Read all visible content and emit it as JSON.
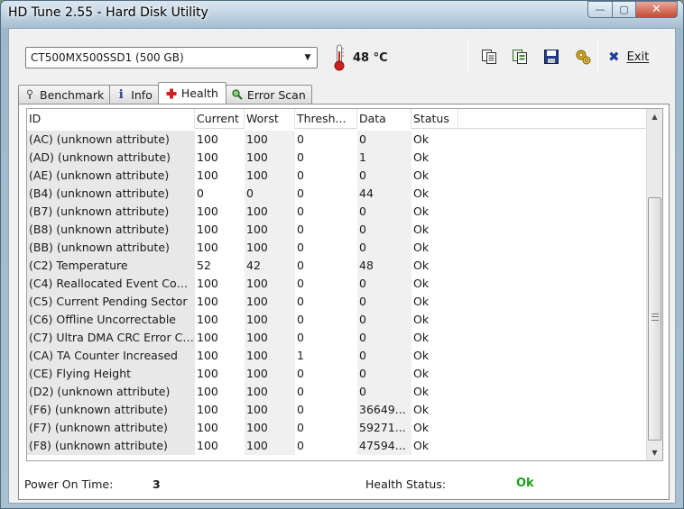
{
  "window": {
    "title": "HD Tune 2.55 - Hard Disk Utility",
    "controls": {
      "minimize": "—",
      "maximize": "▢",
      "close": "✕"
    }
  },
  "toolbar": {
    "drive": "CT500MX500SSD1 (500 GB)",
    "temperature": "48 °C",
    "exit_label": "Exit",
    "icons": [
      "copy-icon",
      "copy-text-icon",
      "save-icon",
      "options-icon"
    ]
  },
  "tabs": [
    {
      "label": "Benchmark",
      "icon": "benchmark-icon"
    },
    {
      "label": "Info",
      "icon": "info-icon"
    },
    {
      "label": "Health",
      "icon": "health-cross-icon",
      "active": true
    },
    {
      "label": "Error Scan",
      "icon": "magnifier-icon"
    }
  ],
  "table": {
    "headers": [
      "ID",
      "Current",
      "Worst",
      "Thresh...",
      "Data",
      "Status"
    ],
    "rows": [
      [
        "(AC) (unknown attribute)",
        "100",
        "100",
        "0",
        "0",
        "Ok"
      ],
      [
        "(AD) (unknown attribute)",
        "100",
        "100",
        "0",
        "1",
        "Ok"
      ],
      [
        "(AE) (unknown attribute)",
        "100",
        "100",
        "0",
        "0",
        "Ok"
      ],
      [
        "(B4) (unknown attribute)",
        "0",
        "0",
        "0",
        "44",
        "Ok"
      ],
      [
        "(B7) (unknown attribute)",
        "100",
        "100",
        "0",
        "0",
        "Ok"
      ],
      [
        "(B8) (unknown attribute)",
        "100",
        "100",
        "0",
        "0",
        "Ok"
      ],
      [
        "(BB) (unknown attribute)",
        "100",
        "100",
        "0",
        "0",
        "Ok"
      ],
      [
        "(C2) Temperature",
        "52",
        "42",
        "0",
        "48",
        "Ok"
      ],
      [
        "(C4) Reallocated Event Coun...",
        "100",
        "100",
        "0",
        "0",
        "Ok"
      ],
      [
        "(C5) Current Pending Sector",
        "100",
        "100",
        "0",
        "0",
        "Ok"
      ],
      [
        "(C6) Offline Uncorrectable",
        "100",
        "100",
        "0",
        "0",
        "Ok"
      ],
      [
        "(C7) Ultra DMA CRC Error Co...",
        "100",
        "100",
        "0",
        "0",
        "Ok"
      ],
      [
        "(CA) TA Counter Increased",
        "100",
        "100",
        "1",
        "0",
        "Ok"
      ],
      [
        "(CE) Flying Height",
        "100",
        "100",
        "0",
        "0",
        "Ok"
      ],
      [
        "(D2) (unknown attribute)",
        "100",
        "100",
        "0",
        "0",
        "Ok"
      ],
      [
        "(F6) (unknown attribute)",
        "100",
        "100",
        "0",
        "36649...",
        "Ok"
      ],
      [
        "(F7) (unknown attribute)",
        "100",
        "100",
        "0",
        "59271...",
        "Ok"
      ],
      [
        "(F8) (unknown attribute)",
        "100",
        "100",
        "0",
        "47594...",
        "Ok"
      ]
    ]
  },
  "footer": {
    "power_on_label": "Power On Time:",
    "power_on_value": "3",
    "health_label": "Health Status:",
    "health_value": "Ok"
  },
  "colors": {
    "health_ok": "#1aa11a",
    "exit_x": "#1f3f9e",
    "thermometer": "#cc1f1f"
  }
}
